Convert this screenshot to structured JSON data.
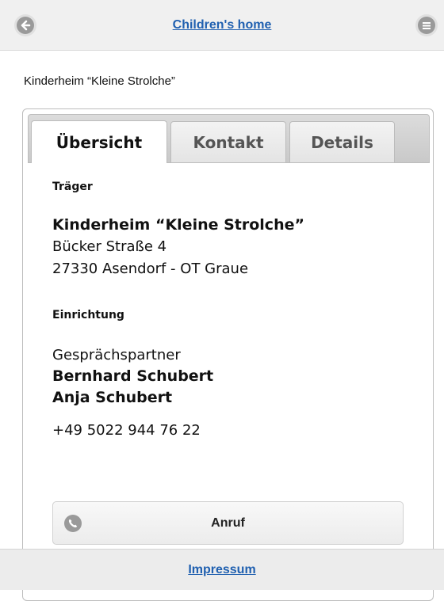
{
  "header": {
    "title": "Children's home",
    "left_icon": "back-arrow-icon",
    "right_icon": "menu-icon"
  },
  "page": {
    "heading": "Kinderheim “Kleine Strolche”"
  },
  "tabs": [
    {
      "label": "Übersicht",
      "active": true
    },
    {
      "label": "Kontakt",
      "active": false
    },
    {
      "label": "Details",
      "active": false
    }
  ],
  "overview": {
    "carrier_label": "Träger",
    "org_name": "Kinderheim “Kleine Strolche”",
    "street": "Bücker Straße 4",
    "city": "27330 Asendorf - OT Graue",
    "facility_label": "Einrichtung",
    "contact_label": "Gesprächspartner",
    "contacts": [
      "Bernhard Schubert",
      "Anja Schubert"
    ],
    "phone": "+49 5022 944 76 22",
    "call_label": "Anruf",
    "call_icon": "phone-icon"
  },
  "footer": {
    "link": "Impressum"
  },
  "colors": {
    "link": "#2060b0",
    "header_bg": "#f0f0f0",
    "icon_bg": "#9a9a9a"
  }
}
